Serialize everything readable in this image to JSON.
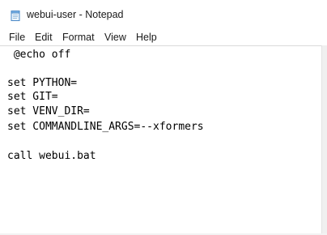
{
  "window": {
    "title": "webui-user - Notepad",
    "icon": "notepad-icon"
  },
  "menu": {
    "items": [
      "File",
      "Edit",
      "Format",
      "View",
      "Help"
    ]
  },
  "editor": {
    "lines": [
      " @echo off",
      "",
      "set PYTHON=",
      "set GIT=",
      "set VENV_DIR=",
      "set COMMANDLINE_ARGS=--xformers",
      "",
      "call webui.bat"
    ]
  }
}
